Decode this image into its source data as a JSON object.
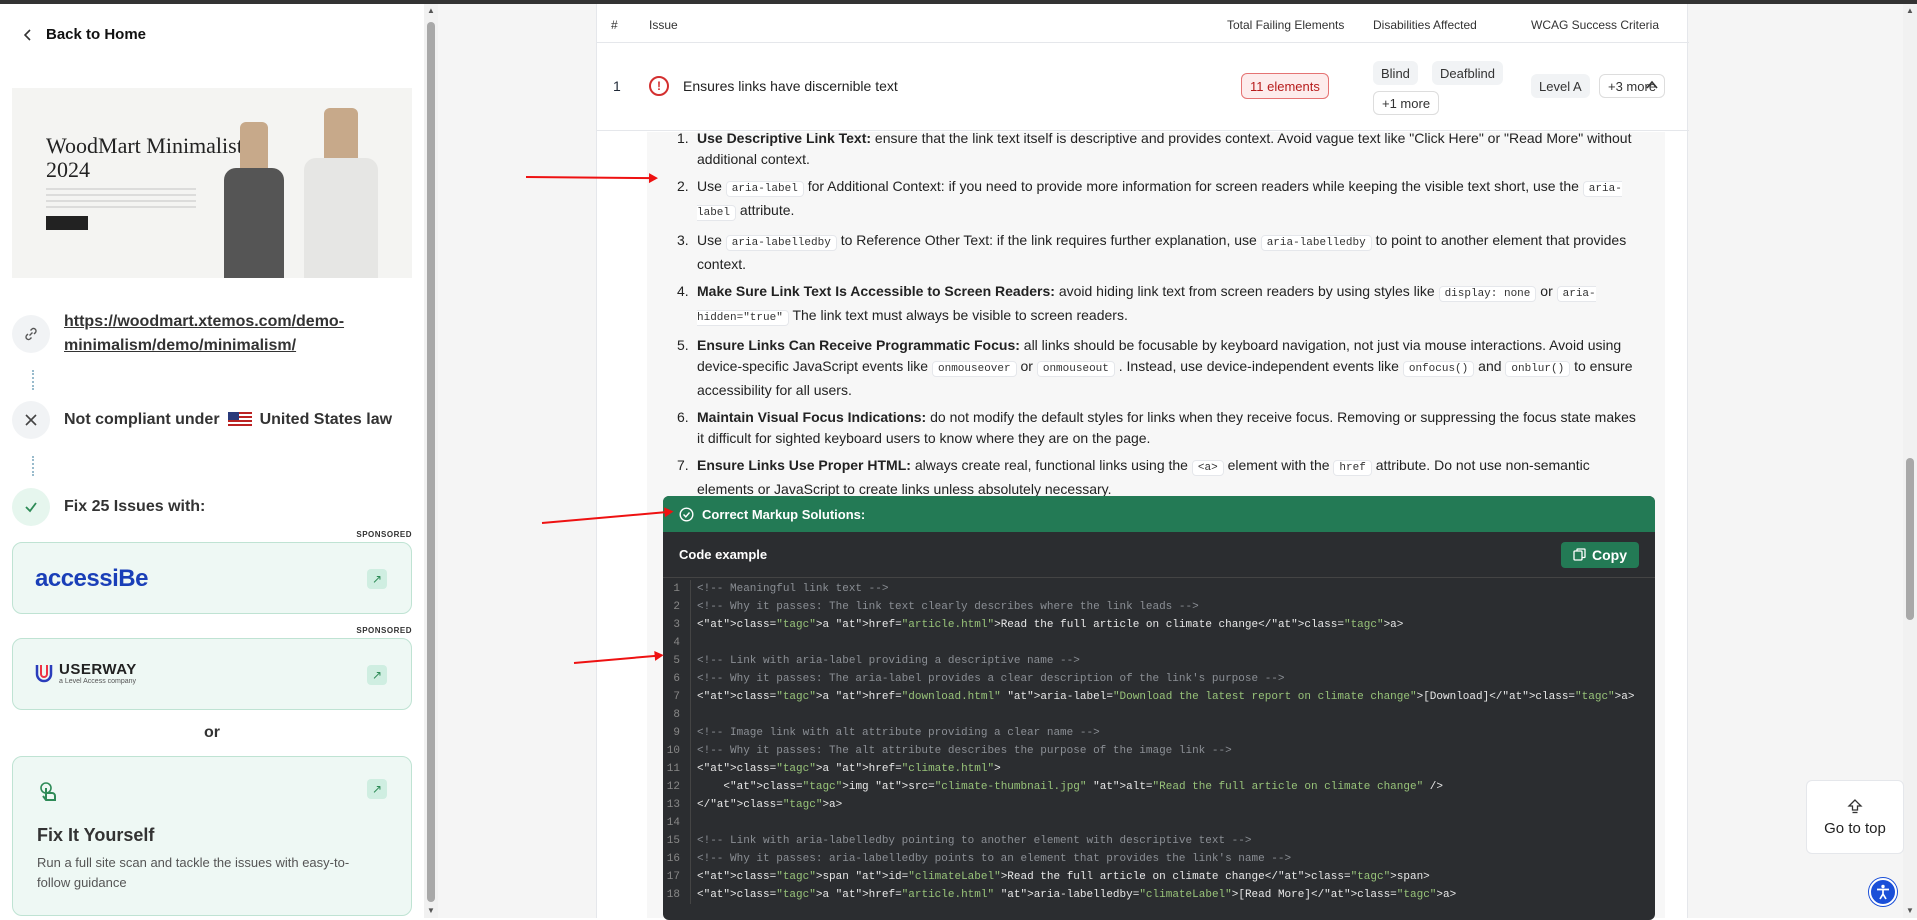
{
  "sidebar": {
    "back_label": "Back to Home",
    "thumb_title": "WoodMart Minimalist 2024",
    "url": "https://woodmart.xtemos.com/demo-minimalism/demo/minimalism/",
    "compliance_prefix": "Not compliant under",
    "compliance_country": "United States law",
    "fix_heading": "Fix 25 Issues with:",
    "sponsored_label": "SPONSORED",
    "accessibe_name": "accessiBe",
    "userway_name": "USERWAY",
    "userway_sub": "a Level Access company",
    "or_label": "or",
    "fiy_title": "Fix It Yourself",
    "fiy_desc": "Run a full site scan and tackle the issues with easy-to-follow guidance"
  },
  "table": {
    "headers": [
      "#",
      "Issue",
      "Total Failing Elements",
      "Disabilities Affected",
      "WCAG Success Criteria"
    ],
    "row": {
      "num": "1",
      "issue": "Ensures links have discernible text",
      "failing": "11 elements",
      "disabilities": [
        "Blind",
        "Deafblind",
        "+1 more"
      ],
      "wcag": [
        "Level A",
        "+3 more"
      ]
    }
  },
  "guidance": {
    "items": [
      {
        "n": "1.",
        "b": "Use Descriptive Link Text:",
        "t": " ensure that the link text itself is descriptive and provides context. Avoid vague text like \"Click Here\" or \"Read More\" without additional context."
      },
      {
        "n": "2.",
        "b": "",
        "t": "Use {aria-label} for Additional Context: if you need to provide more information for screen readers while keeping the visible text short, use the {aria-label} attribute."
      },
      {
        "n": "3.",
        "b": "",
        "t": "Use {aria-labelledby} to Reference Other Text: if the link requires further explanation, use {aria-labelledby} to point to another element that provides context."
      },
      {
        "n": "4.",
        "b": "Make Sure Link Text Is Accessible to Screen Readers:",
        "t": " avoid hiding link text from screen readers by using styles like {display: none} or {aria-hidden=\"true\"} The link text must always be visible to screen readers."
      },
      {
        "n": "5.",
        "b": "Ensure Links Can Receive Programmatic Focus:",
        "t": " all links should be focusable by keyboard navigation, not just via mouse interactions. Avoid using device-specific JavaScript events like {onmouseover} or {onmouseout} . Instead, use device-independent events like {onfocus()} and {onblur()} to ensure accessibility for all users."
      },
      {
        "n": "6.",
        "b": "Maintain Visual Focus Indications:",
        "t": " do not modify the default styles for links when they receive focus. Removing or suppressing the focus state makes it difficult for sighted keyboard users to know where they are on the page."
      },
      {
        "n": "7.",
        "b": "Ensure Links Use Proper HTML:",
        "t": " always create real, functional links using the {<a>} element with the {href} attribute. Do not use non-semantic elements or JavaScript to create links unless absolutely necessary."
      }
    ]
  },
  "code": {
    "section_title": "Correct Markup Solutions:",
    "example_label": "Code example",
    "copy_label": "Copy",
    "lines": [
      "<!-- Meaningful link text -->",
      "<!-- Why it passes: The link text clearly describes where the link leads -->",
      "<a href=\"article.html\">Read the full article on climate change</a>",
      "",
      "<!-- Link with aria-label providing a descriptive name -->",
      "<!-- Why it passes: The aria-label provides a clear description of the link's purpose -->",
      "<a href=\"download.html\" aria-label=\"Download the latest report on climate change\">[Download]</a>",
      "",
      "<!-- Image link with alt attribute providing a clear name -->",
      "<!-- Why it passes: The alt attribute describes the purpose of the image link -->",
      "<a href=\"climate.html\">",
      "    <img src=\"climate-thumbnail.jpg\" alt=\"Read the full article on climate change\" />",
      "</a>",
      "",
      "<!-- Link with aria-labelledby pointing to another element with descriptive text -->",
      "<!-- Why it passes: aria-labelledby points to an element that provides the link's name -->",
      "<span id=\"climateLabel\">Read the full article on climate change</span>",
      "<a href=\"article.html\" aria-labelledby=\"climateLabel\">[Read More]</a>"
    ]
  },
  "go_top_label": "Go to top",
  "colors": {
    "accent_green": "#237a55",
    "error_red": "#d32f2f",
    "link_blue": "#1a4fd8"
  }
}
